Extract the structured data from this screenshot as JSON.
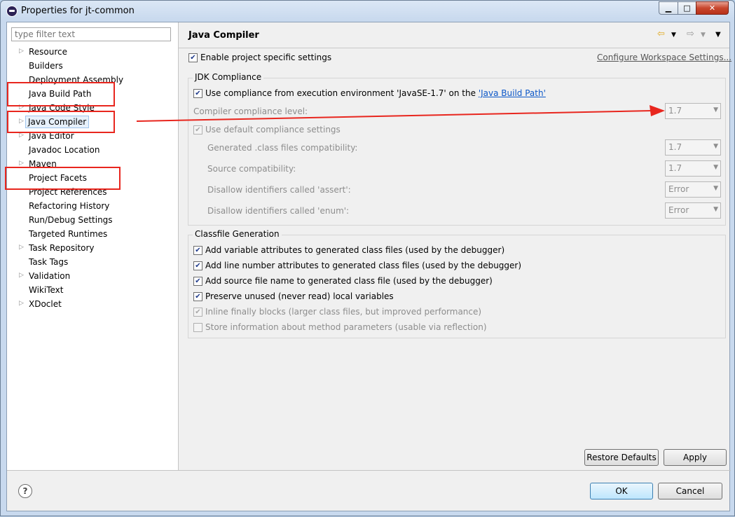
{
  "window": {
    "title": "Properties for jt-common",
    "minimize": "▁",
    "maximize": "□",
    "close": "✕"
  },
  "filter": {
    "placeholder": "type filter text"
  },
  "tree": [
    {
      "label": "Resource",
      "expandable": true
    },
    {
      "label": "Builders",
      "expandable": false
    },
    {
      "label": "Deployment Assembly",
      "expandable": false
    },
    {
      "label": "Java Build Path",
      "expandable": false
    },
    {
      "label": "Java Code Style",
      "expandable": true
    },
    {
      "label": "Java Compiler",
      "expandable": true,
      "selected": true
    },
    {
      "label": "Java Editor",
      "expandable": true
    },
    {
      "label": "Javadoc Location",
      "expandable": false
    },
    {
      "label": "Maven",
      "expandable": true
    },
    {
      "label": "Project Facets",
      "expandable": false
    },
    {
      "label": "Project References",
      "expandable": false
    },
    {
      "label": "Refactoring History",
      "expandable": false
    },
    {
      "label": "Run/Debug Settings",
      "expandable": false
    },
    {
      "label": "Targeted Runtimes",
      "expandable": false
    },
    {
      "label": "Task Repository",
      "expandable": true
    },
    {
      "label": "Task Tags",
      "expandable": false
    },
    {
      "label": "Validation",
      "expandable": true
    },
    {
      "label": "WikiText",
      "expandable": false
    },
    {
      "label": "XDoclet",
      "expandable": true
    }
  ],
  "page": {
    "title": "Java Compiler",
    "enable_specific": "Enable project specific settings",
    "configure_link": "Configure Workspace Settings...",
    "jdk": {
      "group_title": "JDK Compliance",
      "use_compliance_prefix": "Use compliance from execution environment 'JavaSE-1.7' on the ",
      "use_compliance_link": "'Java Build Path'",
      "compliance_level_label": "Compiler compliance level:",
      "compliance_level_value": "1.7",
      "use_default": "Use default compliance settings",
      "rows": [
        {
          "label": "Generated .class files compatibility:",
          "value": "1.7"
        },
        {
          "label": "Source compatibility:",
          "value": "1.7"
        },
        {
          "label": "Disallow identifiers called 'assert':",
          "value": "Error"
        },
        {
          "label": "Disallow identifiers called 'enum':",
          "value": "Error"
        }
      ]
    },
    "classfile": {
      "group_title": "Classfile Generation",
      "options": [
        {
          "label": "Add variable attributes to generated class files (used by the debugger)",
          "checked": true,
          "enabled": true
        },
        {
          "label": "Add line number attributes to generated class files (used by the debugger)",
          "checked": true,
          "enabled": true
        },
        {
          "label": "Add source file name to generated class file (used by the debugger)",
          "checked": true,
          "enabled": true
        },
        {
          "label": "Preserve unused (never read) local variables",
          "checked": true,
          "enabled": true
        },
        {
          "label": "Inline finally blocks (larger class files, but improved performance)",
          "checked": true,
          "enabled": false
        },
        {
          "label": "Store information about method parameters (usable via reflection)",
          "checked": false,
          "enabled": false
        }
      ]
    }
  },
  "buttons": {
    "restore": "Restore Defaults",
    "apply": "Apply",
    "ok": "OK",
    "cancel": "Cancel",
    "help": "?"
  },
  "colors": {
    "annotation_red": "#e8261e",
    "link_blue": "#0b57c8"
  }
}
